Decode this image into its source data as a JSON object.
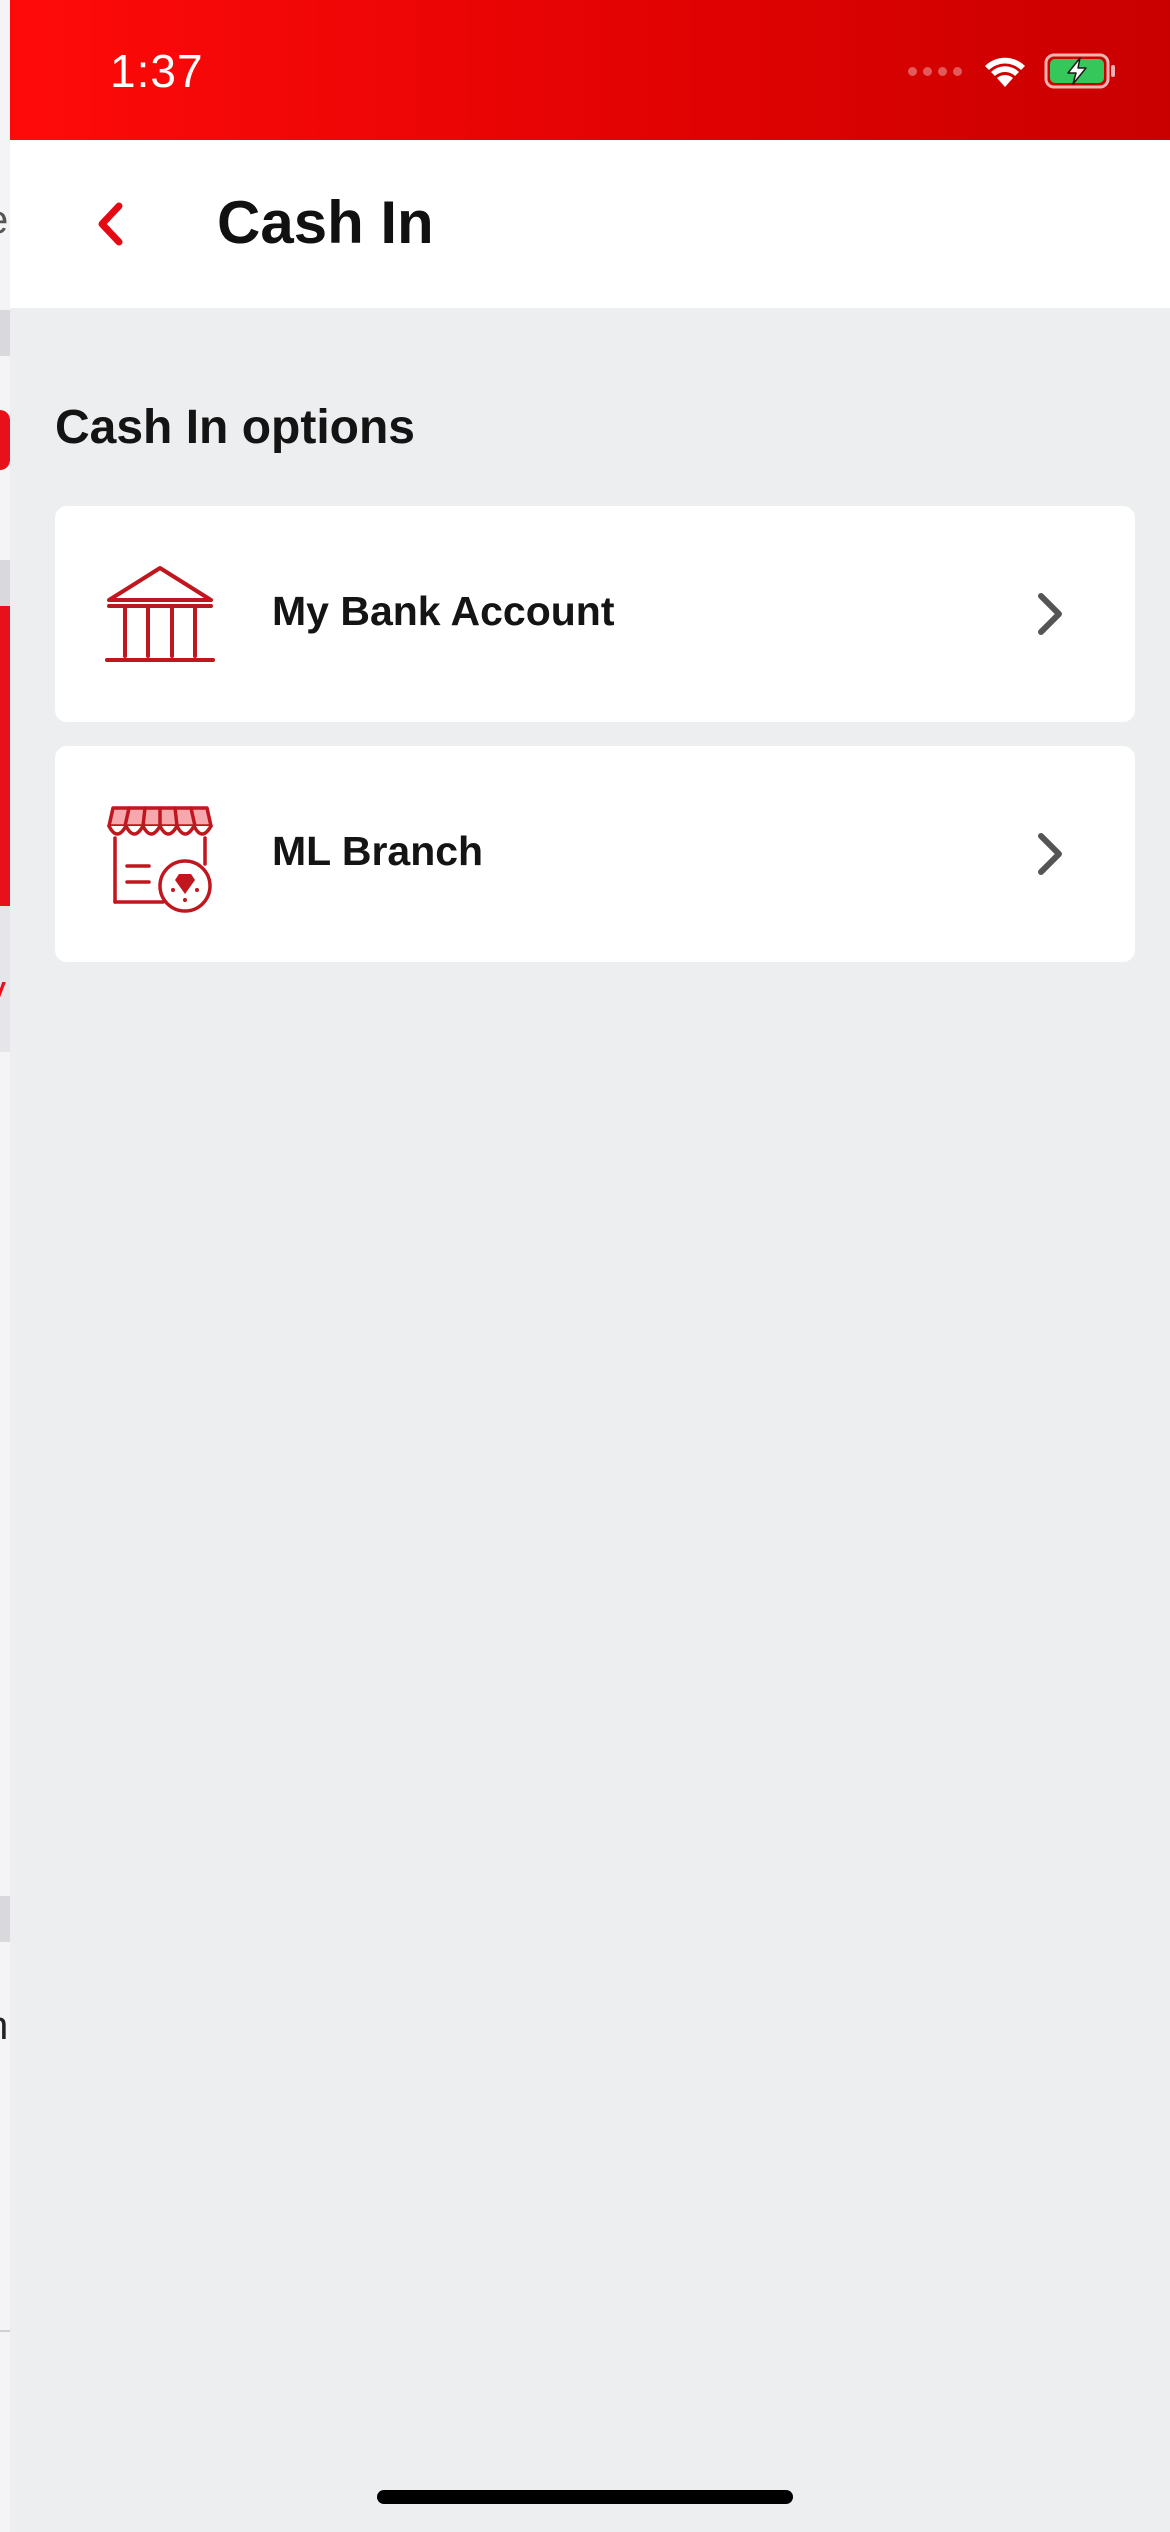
{
  "status_bar": {
    "time": "1:37",
    "wifi_icon": "wifi-icon",
    "battery_icon": "battery-charging-icon",
    "accent_color": "#ff0a0a"
  },
  "nav": {
    "title": "Cash In",
    "back_icon": "chevron-left-icon"
  },
  "section": {
    "title": "Cash In options"
  },
  "options": [
    {
      "label": "My Bank Account",
      "icon": "bank-icon"
    },
    {
      "label": "ML Branch",
      "icon": "store-icon"
    }
  ],
  "background_screen": {
    "edge_chars": [
      "e",
      "y",
      "n"
    ]
  },
  "colors": {
    "brand_red": "#e50914",
    "icon_red": "#c0161e",
    "background": "#edeef0"
  }
}
